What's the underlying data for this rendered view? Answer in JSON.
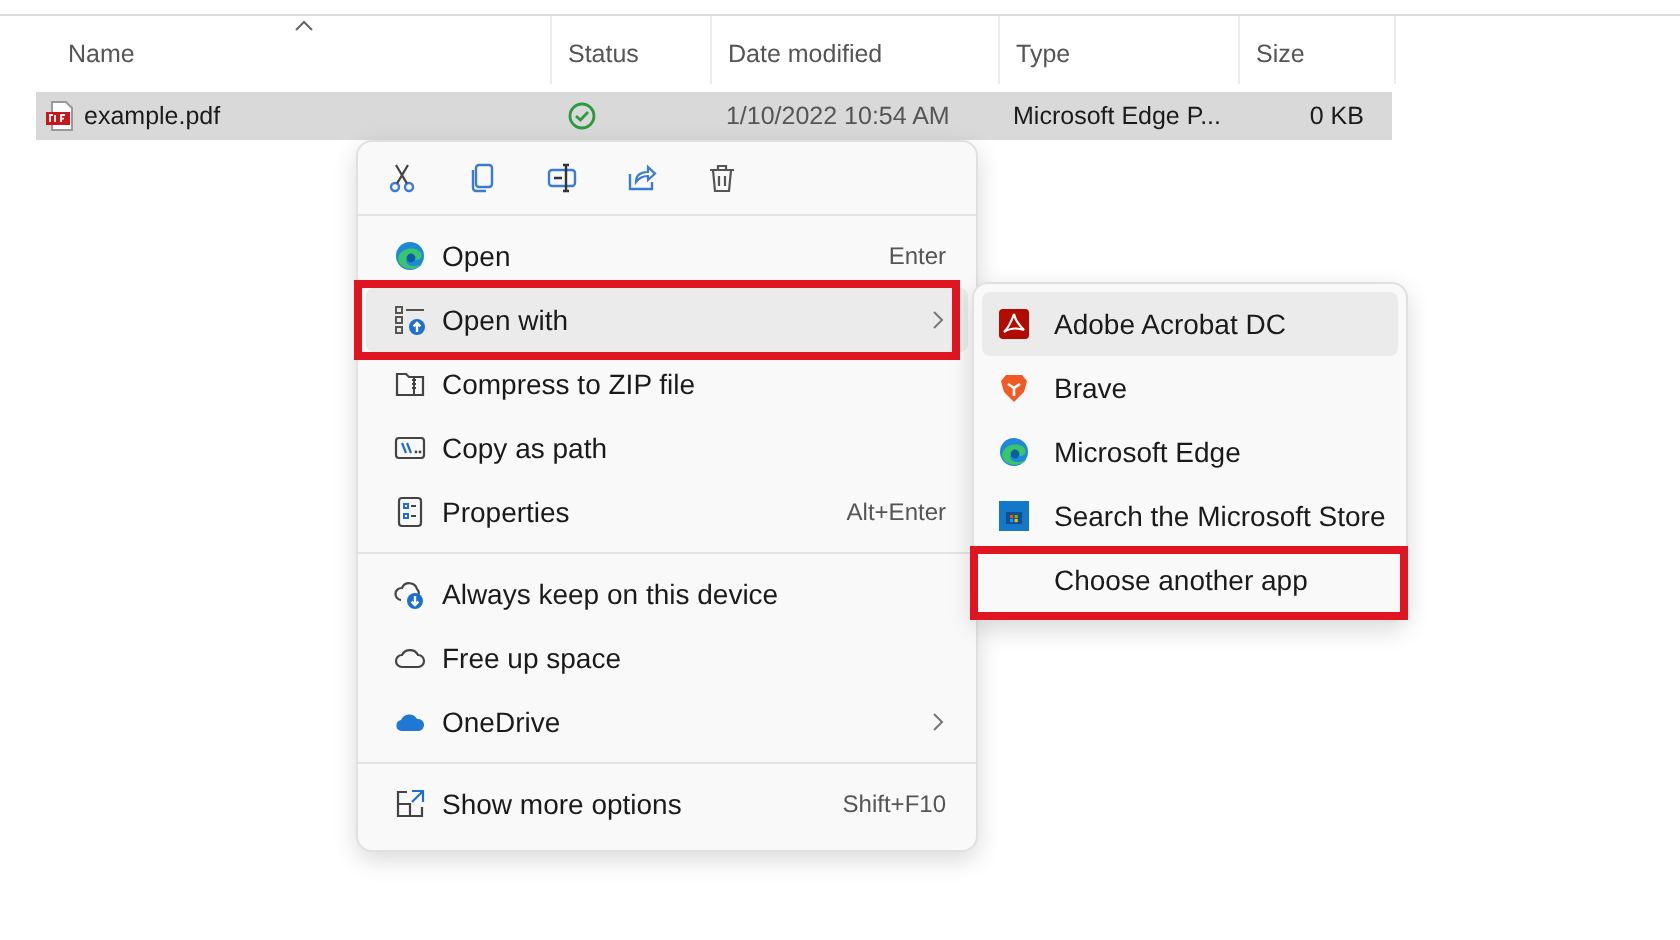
{
  "columns": [
    {
      "label": "Name",
      "sorted": true
    },
    {
      "label": "Status",
      "sorted": false
    },
    {
      "label": "Date modified",
      "sorted": false
    },
    {
      "label": "Type",
      "sorted": false
    },
    {
      "label": "Size",
      "sorted": false
    }
  ],
  "files": [
    {
      "name": "example.pdf",
      "date": "1/10/2022 10:54 AM",
      "type": "Microsoft Edge P...",
      "size": "0 KB",
      "selected": true
    }
  ],
  "context_menu": {
    "toolbar": [
      {
        "kind": "cut"
      },
      {
        "kind": "copy"
      },
      {
        "kind": "rename"
      },
      {
        "kind": "share"
      },
      {
        "kind": "delete"
      }
    ],
    "sections": [
      [
        {
          "kind": "edge",
          "label": "Open",
          "shortcut": "Enter",
          "submenu": false,
          "selected": false,
          "highlighted": false
        },
        {
          "kind": "open-with",
          "label": "Open with",
          "submenu": true,
          "selected": true,
          "highlighted": true
        },
        {
          "kind": "zip",
          "label": "Compress to ZIP file",
          "submenu": false,
          "selected": false,
          "highlighted": false
        },
        {
          "kind": "copy-path",
          "label": "Copy as path",
          "submenu": false,
          "selected": false,
          "highlighted": false
        },
        {
          "kind": "properties",
          "label": "Properties",
          "shortcut": "Alt+Enter",
          "submenu": false,
          "selected": false,
          "highlighted": false
        }
      ],
      [
        {
          "kind": "keep-device",
          "label": "Always keep on this device",
          "submenu": false,
          "selected": false,
          "highlighted": false
        },
        {
          "kind": "cloud",
          "label": "Free up space",
          "submenu": false,
          "selected": false,
          "highlighted": false
        },
        {
          "kind": "onedrive",
          "label": "OneDrive",
          "submenu": true,
          "selected": false,
          "highlighted": false
        }
      ],
      [
        {
          "kind": "more-options",
          "label": "Show more options",
          "shortcut": "Shift+F10",
          "submenu": false,
          "selected": false,
          "highlighted": false
        }
      ]
    ]
  },
  "submenu": [
    {
      "kind": "acrobat",
      "label": "Adobe Acrobat DC",
      "selected": true,
      "highlighted": false
    },
    {
      "kind": "brave",
      "label": "Brave",
      "selected": false,
      "highlighted": false
    },
    {
      "kind": "edge",
      "label": "Microsoft Edge",
      "selected": false,
      "highlighted": false
    },
    {
      "kind": "store",
      "label": "Search the Microsoft Store",
      "selected": false,
      "highlighted": false
    },
    {
      "kind": "plain",
      "label": "Choose another app",
      "selected": false,
      "highlighted": true
    }
  ]
}
